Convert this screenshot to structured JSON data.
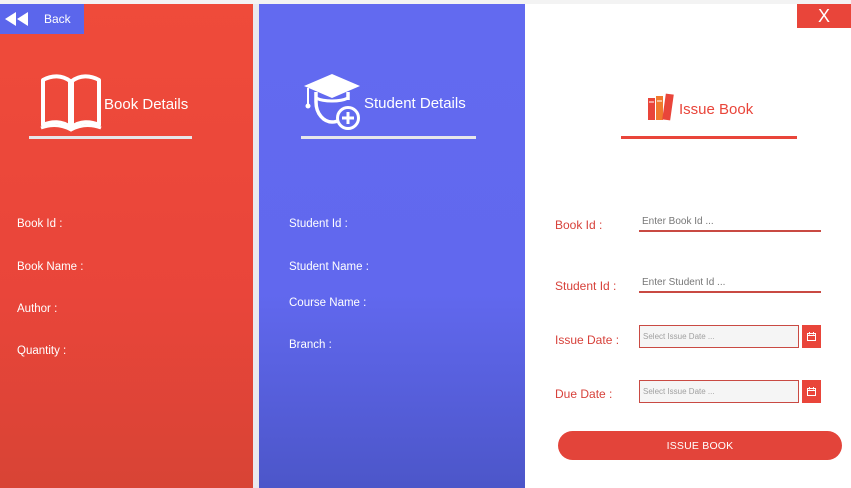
{
  "nav": {
    "back_label": "Back",
    "close_label": "X"
  },
  "book_panel": {
    "title": "Book Details",
    "fields": [
      {
        "label": "Book Id :"
      },
      {
        "label": "Book Name :"
      },
      {
        "label": "Author :"
      },
      {
        "label": "Quantity :"
      }
    ]
  },
  "student_panel": {
    "title": "Student Details",
    "fields": [
      {
        "label": "Student Id :"
      },
      {
        "label": "Student Name :"
      },
      {
        "label": "Course Name :"
      },
      {
        "label": "Branch :"
      }
    ]
  },
  "issue_panel": {
    "title": "Issue Book",
    "book_id": {
      "label": "Book Id :",
      "placeholder": "Enter Book Id ...",
      "value": ""
    },
    "student_id": {
      "label": "Student Id :",
      "placeholder": "Enter Student Id ...",
      "value": ""
    },
    "issue_date": {
      "label": "Issue Date :",
      "placeholder": "Select Issue Date ...",
      "value": ""
    },
    "due_date": {
      "label": "Due Date :",
      "placeholder": "Select Issue Date ...",
      "value": ""
    },
    "submit_label": "ISSUE BOOK"
  },
  "colors": {
    "book_panel": "#ef4b3a",
    "student_panel": "#626af0",
    "accent": "#e9453a"
  },
  "icons": {
    "back": "double-chevron-left-icon",
    "book": "open-book-icon",
    "student": "graduate-add-icon",
    "issue": "books-stack-icon",
    "calendar": "calendar-icon"
  }
}
